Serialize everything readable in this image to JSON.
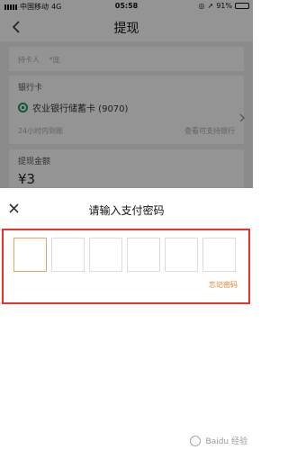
{
  "status_bar": {
    "carrier": "中国移动",
    "network": "4G",
    "time": "05:58",
    "battery": "91%",
    "battery_level": 0.91
  },
  "nav": {
    "title": "提现"
  },
  "withdraw_form": {
    "holder_label": "持卡人",
    "holder_value": "*庞",
    "bank_card_label": "银行卡",
    "bank_name": "农业银行储蓄卡 (9070)",
    "arrival_time": "24小时内到账",
    "supported_banks_link": "查看可支持银行",
    "amount_label": "提现金额",
    "amount_value": "¥3"
  },
  "password_sheet": {
    "title": "请输入支付密码",
    "pin_length": 6,
    "active_index": 0,
    "forgot_password": "忘记密码",
    "highlight_color": "#e8342a"
  },
  "watermark": {
    "text": "Baidu 经验"
  },
  "colors": {
    "accent": "#f07c2a",
    "bank_green": "#1d9a5c"
  },
  "icons": {
    "back": "chevron-left-icon",
    "close": "close-icon",
    "bank": "bank-logo-icon",
    "chevron": "chevron-right-icon"
  }
}
